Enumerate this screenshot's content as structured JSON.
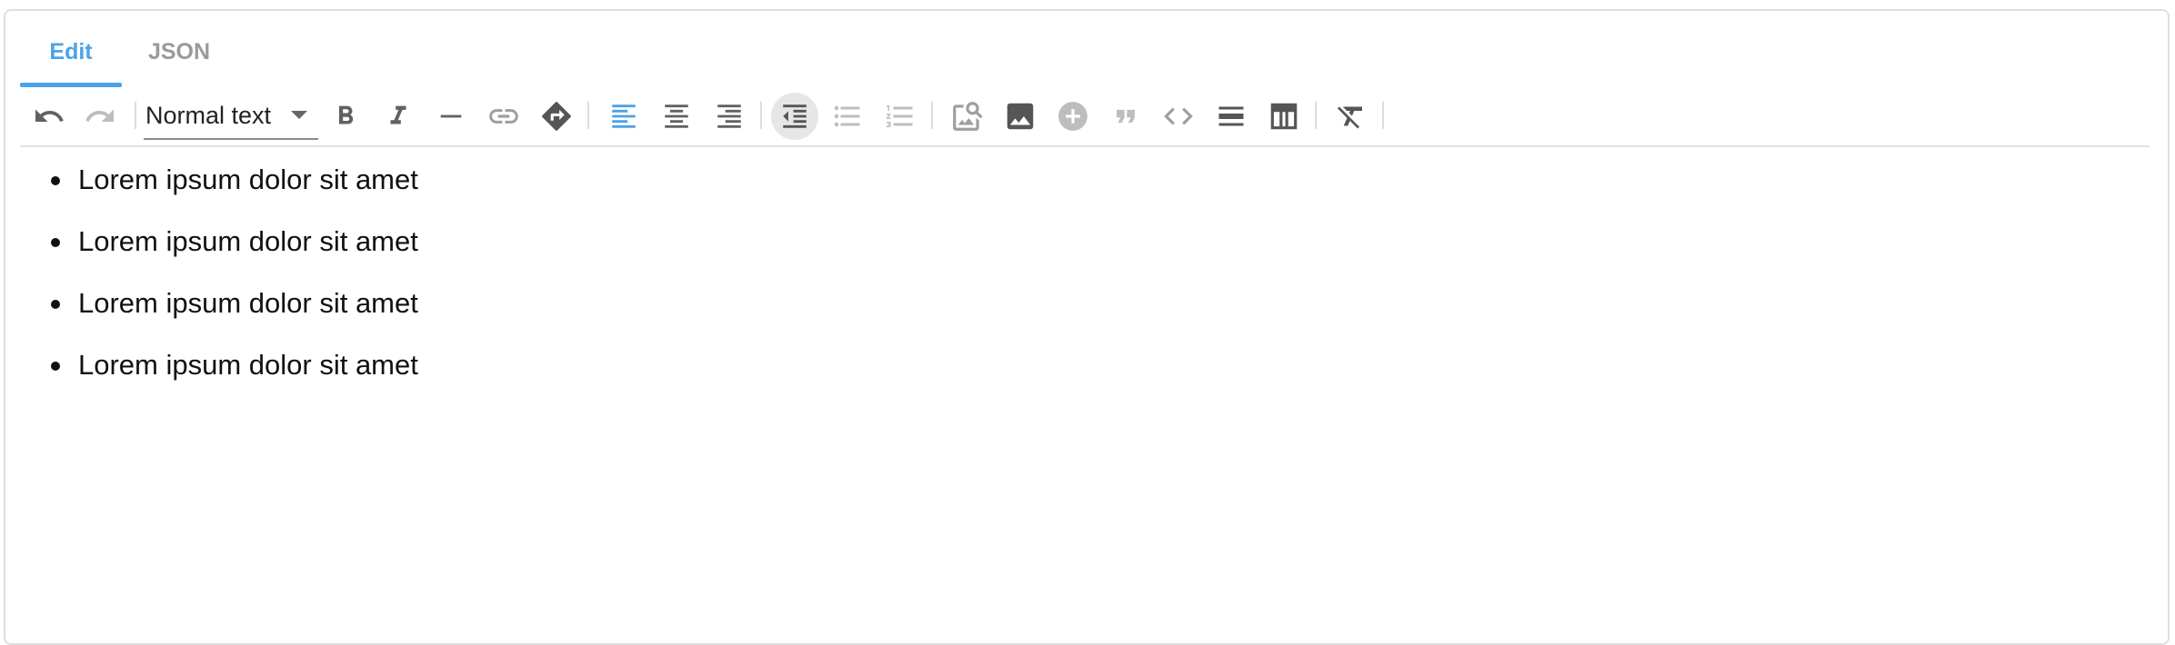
{
  "tabs": [
    {
      "label": "Edit",
      "active": true
    },
    {
      "label": "JSON",
      "active": false
    }
  ],
  "toolbar": {
    "text_style": "Normal text",
    "buttons": [
      "undo-icon",
      "redo-icon",
      "bold-icon",
      "italic-icon",
      "horizontal-rule-icon",
      "link-icon",
      "highlight-icon",
      "align-left-icon",
      "align-center-icon",
      "align-right-icon",
      "outdent-icon",
      "bullet-list-icon",
      "ordered-list-icon",
      "image-search-icon",
      "image-icon",
      "add-icon",
      "quote-icon",
      "code-icon",
      "divider-icon",
      "table-icon",
      "clear-format-icon"
    ],
    "accent_color": "#4aa3e8"
  },
  "content": {
    "list_items": [
      "Lorem ipsum dolor sit amet",
      "Lorem ipsum dolor sit amet",
      "Lorem ipsum dolor sit amet",
      "Lorem ipsum dolor sit amet"
    ]
  }
}
